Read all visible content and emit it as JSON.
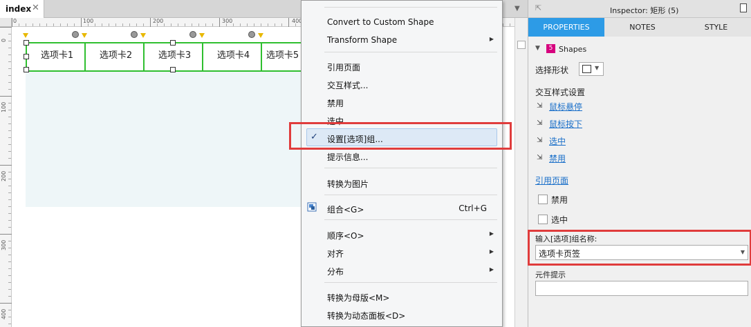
{
  "document_tab": {
    "label": "index",
    "close": "✕"
  },
  "ruler": {
    "h_labels": [
      "0",
      "100",
      "200",
      "300",
      "400"
    ],
    "v_labels": [
      "0",
      "100",
      "200",
      "300",
      "400"
    ]
  },
  "canvas": {
    "tabs": [
      "选项卡1",
      "选项卡2",
      "选项卡3",
      "选项卡4",
      "选项卡5"
    ]
  },
  "context_menu": {
    "items": [
      {
        "label": "Convert to Custom Shape",
        "submenu": false
      },
      {
        "label": "Transform Shape",
        "submenu": true
      },
      {
        "label": "引用页面",
        "submenu": false
      },
      {
        "label": "交互样式...",
        "submenu": false
      },
      {
        "label": "禁用",
        "submenu": false
      },
      {
        "label": "选中",
        "submenu": false
      },
      {
        "label": "设置[选项]组...",
        "submenu": false,
        "checked": true,
        "highlighted": true
      },
      {
        "label": "提示信息...",
        "submenu": false
      },
      {
        "label": "转换为图片",
        "submenu": false
      },
      {
        "label": "组合<G>",
        "shortcut": "Ctrl+G",
        "submenu": false
      },
      {
        "label": "顺序<O>",
        "submenu": true
      },
      {
        "label": "对齐",
        "submenu": true
      },
      {
        "label": "分布",
        "submenu": true
      },
      {
        "label": "转换为母版<M>",
        "submenu": false
      },
      {
        "label": "转换为动态面板<D>",
        "submenu": false
      }
    ],
    "check_glyph": "✓",
    "submenu_glyph": "▶"
  },
  "inspector": {
    "title": "Inspector: 矩形 (5)",
    "tabs": [
      "PROPERTIES",
      "NOTES",
      "STYLE"
    ],
    "active_tab": "PROPERTIES",
    "shapes": {
      "count": "5",
      "label": "Shapes"
    },
    "select_shape_label": "选择形状",
    "interaction_style_heading": "交互样式设置",
    "interaction_links": [
      "鼠标悬停",
      "鼠标按下",
      "选中",
      "禁用"
    ],
    "reference_page_link": "引用页面",
    "disabled_checkbox_label": "禁用",
    "selected_checkbox_label": "选中",
    "group_name_label": "输入[选项]组名称:",
    "group_name_value": "选项卡页签",
    "element_hint_label": "元件提示",
    "element_hint_value": ""
  },
  "colors": {
    "accent_tab": "#2d9be6",
    "highlight_red": "#e03c3c",
    "selection_green": "#2fbf2f",
    "shape_badge": "#d6007e",
    "link_blue": "#1a6fc9"
  },
  "icons": {
    "collapse": "collapse-icon",
    "page": "page-icon",
    "group": "group-icon",
    "shape_chevron": "chevron-down-icon"
  }
}
